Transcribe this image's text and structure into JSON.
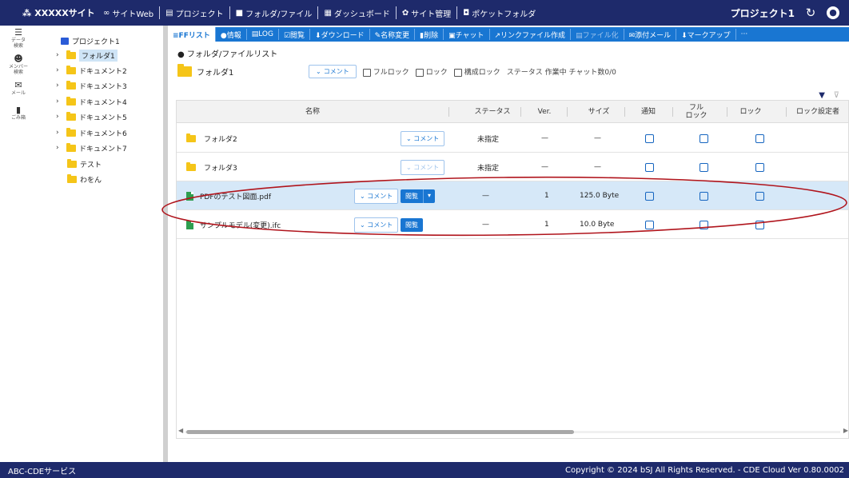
{
  "app": {
    "brand": "XXXXXサイト",
    "project": "プロジェクト1"
  },
  "nav": [
    {
      "icon": "link-icon",
      "glyph": "∞",
      "label": "サイトWeb"
    },
    {
      "icon": "project-icon",
      "glyph": "▤",
      "label": "プロジェクト"
    },
    {
      "icon": "folder-icon",
      "glyph": "■",
      "label": "フォルダ/ファイル"
    },
    {
      "icon": "dashboard-icon",
      "glyph": "▦",
      "label": "ダッシュボード"
    },
    {
      "icon": "gear-icon",
      "glyph": "✿",
      "label": "サイト管理"
    },
    {
      "icon": "pocket-icon",
      "glyph": "◘",
      "label": "ポケットフォルダ"
    }
  ],
  "rail": [
    {
      "icon": "data-search-icon",
      "glyph": "☰",
      "label": "データ\n検索"
    },
    {
      "icon": "member-search-icon",
      "glyph": "☻",
      "label": "メンバー\n検索"
    },
    {
      "icon": "mail-icon",
      "glyph": "✉",
      "label": "メール"
    },
    {
      "icon": "trash-icon",
      "glyph": "▮",
      "label": "ごみ箱"
    }
  ],
  "tree": {
    "root": "プロジェクト1",
    "items": [
      {
        "label": "フォルダ1",
        "chev": "›",
        "selected": true
      },
      {
        "label": "ドキュメント2",
        "chev": "›"
      },
      {
        "label": "ドキュメント3",
        "chev": "›"
      },
      {
        "label": "ドキュメント4",
        "chev": "›"
      },
      {
        "label": "ドキュメント5",
        "chev": "›"
      },
      {
        "label": "ドキュメント6",
        "chev": "›"
      },
      {
        "label": "ドキュメント7",
        "chev": "›"
      },
      {
        "label": "テスト",
        "chev": ""
      },
      {
        "label": "わをん",
        "chev": ""
      }
    ]
  },
  "toolbar": [
    {
      "label": "≡FFリスト",
      "state": "active"
    },
    {
      "label": "●情報"
    },
    {
      "label": "▤LOG"
    },
    {
      "label": "☑閲覧"
    },
    {
      "label": "⬇ダウンロード"
    },
    {
      "label": "✎名称変更"
    },
    {
      "label": "▮削除"
    },
    {
      "label": "▣チャット"
    },
    {
      "label": "↗リンクファイル作成"
    },
    {
      "label": "▤ファイル化",
      "state": "disabled"
    },
    {
      "label": "✉添付メール"
    },
    {
      "label": "⬇マークアップ"
    },
    {
      "label": "···"
    }
  ],
  "main": {
    "heading": "● フォルダ/ファイルリスト",
    "folder_name": "フォルダ1",
    "comment_label": "コメント",
    "options": [
      "フルロック",
      "ロック",
      "構成ロック"
    ],
    "status_text": "ステータス 作業中  チャット数0/0"
  },
  "table": {
    "columns": [
      "名称",
      "ステータス",
      "Ver.",
      "サイズ",
      "通知",
      "フル\nロック",
      "ロック",
      "ロック設定者"
    ],
    "rows": [
      {
        "type": "folder",
        "name": "フォルダ2",
        "comment": "コメント",
        "status": "未指定",
        "ver": "—",
        "size": "—"
      },
      {
        "type": "folder",
        "name": "フォルダ3",
        "comment": "コメント",
        "status": "未指定",
        "ver": "—",
        "size": "—"
      },
      {
        "type": "file",
        "name": "PDFのテスト図面.pdf",
        "comment": "コメント",
        "view": "閲覧",
        "status": "—",
        "ver": "1",
        "size": "125.0 Byte"
      },
      {
        "type": "file",
        "name": "サンプルモデル(変更).ifc",
        "comment": "コメント",
        "view": "閲覧",
        "status": "—",
        "ver": "1",
        "size": "10.0 Byte"
      }
    ]
  },
  "colors": {
    "nav": "#1e2a6b",
    "toolbar": "#1976d2",
    "highlight_row": "#d6e8f8",
    "annotation": "#b0141c"
  },
  "footer": {
    "left": "ABC-CDEサービス",
    "right": "Copyright © 2024 bSJ All Rights Reserved. - CDE Cloud Ver 0.80.0002"
  }
}
